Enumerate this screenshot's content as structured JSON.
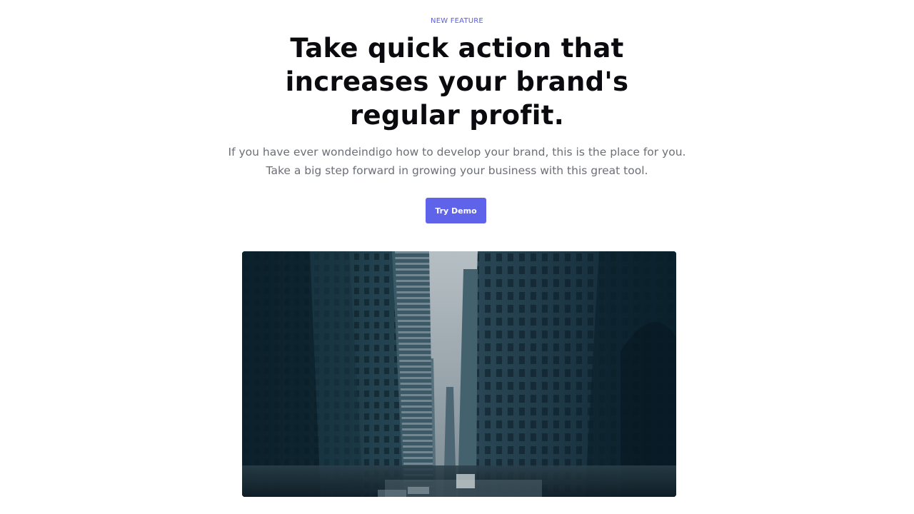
{
  "hero": {
    "eyebrow": "NEW FEATURE",
    "headline": "Take quick action that increases your brand's regular profit.",
    "subtext_line1": "If you have ever wondeindigo how to develop your brand, this is the place for you.",
    "subtext_line2": "Take a big step forward in growing your business with this great tool.",
    "cta_label": "Try Demo"
  },
  "colors": {
    "accent": "#5f63ea",
    "eyebrow": "#5b5fe0",
    "headline": "#0b0b0f",
    "subtext": "#6b6f76",
    "image_tint": "#1a3442"
  },
  "image": {
    "subject": "city-street-skyscrapers-photo"
  }
}
